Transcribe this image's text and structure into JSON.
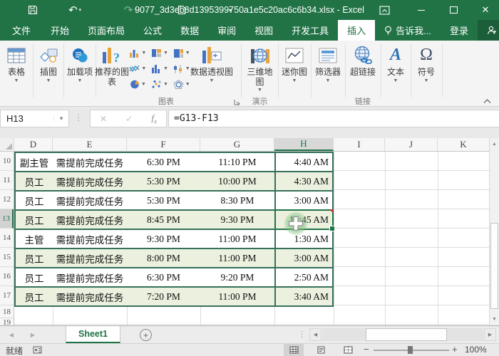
{
  "window": {
    "title": "9077_3d3eb8d1395399750a1e5c20ac6c6b34.xlsx - Excel"
  },
  "tabs": {
    "file": "文件",
    "items": [
      "开始",
      "页面布局",
      "公式",
      "数据",
      "审阅",
      "视图",
      "开发工具"
    ],
    "active": "插入",
    "tell_me": "告诉我...",
    "sign_in": "登录",
    "share": "共享"
  },
  "ribbon": {
    "tables": "表格",
    "illustrations": "插图",
    "add_ins": "加载项",
    "recommended_charts": "推荐的图表",
    "pivot_chart": "数据透视图",
    "map_3d": "三维地图",
    "sparklines": "迷你图",
    "slicers": "筛选器",
    "hyperlink": "超链接",
    "text": "文本",
    "symbols": "符号",
    "group_charts": "图表",
    "group_tours": "演示",
    "group_links": "链接"
  },
  "formula_bar": {
    "name_box": "H13",
    "formula": "=G13-F13"
  },
  "sheet": {
    "columns": [
      "D",
      "E",
      "F",
      "G",
      "H",
      "I",
      "J",
      "K"
    ],
    "active_column": "H",
    "active_cell": "H13",
    "rows": [
      {
        "n": "10",
        "role": "副主管",
        "task": "需提前完成任务",
        "start": "6:30 PM",
        "end": "11:10 PM",
        "result": "4:40 AM"
      },
      {
        "n": "11",
        "role": "员工",
        "task": "需提前完成任务",
        "start": "5:30 PM",
        "end": "10:00 PM",
        "result": "4:30 AM"
      },
      {
        "n": "12",
        "role": "员工",
        "task": "需提前完成任务",
        "start": "5:30 PM",
        "end": "8:30 PM",
        "result": "3:00 AM"
      },
      {
        "n": "13",
        "role": "员工",
        "task": "需提前完成任务",
        "start": "8:45 PM",
        "end": "9:30 PM",
        "result": "12:45 AM"
      },
      {
        "n": "14",
        "role": "主管",
        "task": "需提前完成任务",
        "start": "9:30 PM",
        "end": "11:00 PM",
        "result": "1:30 AM"
      },
      {
        "n": "15",
        "role": "员工",
        "task": "需提前完成任务",
        "start": "8:00 PM",
        "end": "11:00 PM",
        "result": "3:00 AM"
      },
      {
        "n": "16",
        "role": "员工",
        "task": "需提前完成任务",
        "start": "6:30 PM",
        "end": "9:20 PM",
        "result": "2:50 AM"
      },
      {
        "n": "17",
        "role": "员工",
        "task": "需提前完成任务",
        "start": "7:20 PM",
        "end": "11:00 PM",
        "result": "3:40 AM"
      }
    ],
    "empty_rows": [
      "18",
      "19"
    ]
  },
  "sheet_bar": {
    "tab": "Sheet1"
  },
  "status_bar": {
    "mode": "就绪",
    "zoom": "100%"
  },
  "colors": {
    "accent": "#217346",
    "band": "#ebf1de",
    "table_border": "#35705b"
  }
}
